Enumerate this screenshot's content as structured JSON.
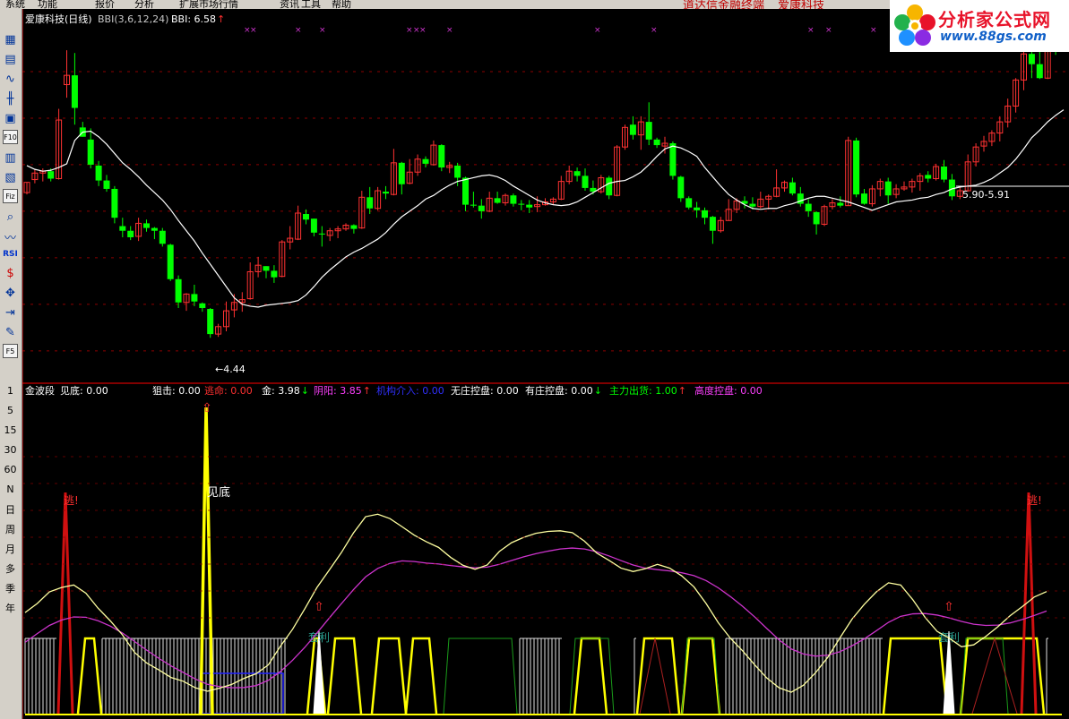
{
  "menu": {
    "items": [
      "系统",
      "功能",
      "报价",
      "分析",
      "扩展市场行情",
      "资讯",
      "工具",
      "帮助"
    ],
    "headline": "道达信金融终端",
    "headline_stock": "爱康科技"
  },
  "logo": {
    "brand": "分析家公式网",
    "url": "www.88gs.com",
    "icon": "flower-logo-icon"
  },
  "toolbar": {
    "icons": [
      "grid-icon",
      "table-icon",
      "line-chart-icon",
      "kline-icon",
      "window-icon",
      "f10-icon",
      "notes-icon",
      "calendar-icon",
      "f10-box-icon",
      "search-icon",
      "wave-icon",
      "rsi-icon",
      "dollar-icon",
      "move-icon",
      "export-icon",
      "draw-pencil-icon",
      "f5-icon"
    ],
    "labels": {
      "f10": "F10",
      "fiz": "Fiz",
      "f5": "F5",
      "rsi": "RSI"
    },
    "periods": [
      "1",
      "5",
      "15",
      "30",
      "60",
      "N",
      "日",
      "周",
      "月",
      "多",
      "季",
      "年"
    ]
  },
  "main_panel": {
    "title": "爱康科技(日线)",
    "indicator": "BBI(3,6,12,24)",
    "bbi_label": "BBI: 6.58",
    "bbi_arrow": "↑",
    "low_label": "←4.44",
    "range_label": "5.90-5.91"
  },
  "sub_panel": {
    "title": "金波段",
    "readouts": [
      {
        "label": "见底:",
        "value": "0.00",
        "color": "#ffffff",
        "arrow": ""
      },
      {
        "label": "狙击:",
        "value": "0.00",
        "color": "#ffffff",
        "arrow": ""
      },
      {
        "label": "逃命:",
        "value": "0.00",
        "color": "#ff3030",
        "arrow": ""
      },
      {
        "label": "金:",
        "value": "3.98",
        "color": "#ffffff",
        "arrow": "↓"
      },
      {
        "label": "阴阳:",
        "value": "3.85",
        "color": "#ff40ff",
        "arrow": "↑"
      },
      {
        "label": "机构介入:",
        "value": "0.00",
        "color": "#3030ff",
        "arrow": ""
      },
      {
        "label": "无庄控盘:",
        "value": "0.00",
        "color": "#ffffff",
        "arrow": ""
      },
      {
        "label": "有庄控盘:",
        "value": "0.00",
        "color": "#ffffff",
        "arrow": "↓"
      },
      {
        "label": "主力出货:",
        "value": "1.00",
        "color": "#00ff00",
        "arrow": "↑"
      },
      {
        "label": "高度控盘:",
        "value": "0.00",
        "color": "#ff40ff",
        "arrow": ""
      }
    ],
    "annotations": {
      "bottom": "见底",
      "escape": "逃!",
      "profit": "套利"
    }
  },
  "colors": {
    "up": "#ff3232",
    "down": "#00ff00",
    "bbi": "#ffffff",
    "gold": "#ffffa0",
    "yinyang": "#cc33cc",
    "yellow": "#ffff00",
    "grid": "#8b0000",
    "axis": "#ff0000"
  },
  "chart_data": [
    {
      "type": "candlestick",
      "title": "爱康科技(日线)",
      "ylim": [
        4.2,
        8.0
      ],
      "candles": [
        [
          6.2,
          6.31,
          6.18,
          6.31
        ],
        [
          6.34,
          6.45,
          6.3,
          6.41
        ],
        [
          6.41,
          6.46,
          6.32,
          6.43
        ],
        [
          6.43,
          6.46,
          6.32,
          6.35
        ],
        [
          6.35,
          7.1,
          6.34,
          6.98
        ],
        [
          7.36,
          7.73,
          7.22,
          7.46
        ],
        [
          7.46,
          7.7,
          6.93,
          7.11
        ],
        [
          6.9,
          6.96,
          6.8,
          6.8
        ],
        [
          6.77,
          6.89,
          6.46,
          6.5
        ],
        [
          6.49,
          6.54,
          6.27,
          6.33
        ],
        [
          6.33,
          6.39,
          6.21,
          6.24
        ],
        [
          6.24,
          6.27,
          5.87,
          5.93
        ],
        [
          5.84,
          5.93,
          5.72,
          5.79
        ],
        [
          5.79,
          5.84,
          5.69,
          5.72
        ],
        [
          5.73,
          5.93,
          5.68,
          5.87
        ],
        [
          5.87,
          5.91,
          5.78,
          5.82
        ],
        [
          5.82,
          5.83,
          5.7,
          5.79
        ],
        [
          5.79,
          5.82,
          5.62,
          5.65
        ],
        [
          5.64,
          5.65,
          5.25,
          5.27
        ],
        [
          5.27,
          5.31,
          4.96,
          5.02
        ],
        [
          5.02,
          5.12,
          4.93,
          5.11
        ],
        [
          5.11,
          5.21,
          4.98,
          5.03
        ],
        [
          5.01,
          5.02,
          4.92,
          4.96
        ],
        [
          4.95,
          4.96,
          4.64,
          4.68
        ],
        [
          4.68,
          4.79,
          4.65,
          4.76
        ],
        [
          4.76,
          5.03,
          4.71,
          4.93
        ],
        [
          4.94,
          5.11,
          4.86,
          5.02
        ],
        [
          5.02,
          5.13,
          4.92,
          5.05
        ],
        [
          5.06,
          5.45,
          5.05,
          5.35
        ],
        [
          5.35,
          5.51,
          5.29,
          5.42
        ],
        [
          5.41,
          5.41,
          5.28,
          5.36
        ],
        [
          5.36,
          5.42,
          5.23,
          5.29
        ],
        [
          5.3,
          5.69,
          5.29,
          5.67
        ],
        [
          5.67,
          5.84,
          5.59,
          5.71
        ],
        [
          5.7,
          6.06,
          5.69,
          5.98
        ],
        [
          5.97,
          6.02,
          5.86,
          5.91
        ],
        [
          5.92,
          5.92,
          5.73,
          5.77
        ],
        [
          5.76,
          5.84,
          5.62,
          5.75
        ],
        [
          5.74,
          5.82,
          5.68,
          5.79
        ],
        [
          5.79,
          5.84,
          5.71,
          5.81
        ],
        [
          5.81,
          5.87,
          5.79,
          5.85
        ],
        [
          5.85,
          5.86,
          5.76,
          5.81
        ],
        [
          5.82,
          6.22,
          5.81,
          6.15
        ],
        [
          6.15,
          6.26,
          5.97,
          6.03
        ],
        [
          6.03,
          6.26,
          6.01,
          6.22
        ],
        [
          6.21,
          6.27,
          6.13,
          6.19
        ],
        [
          6.18,
          6.67,
          6.17,
          6.52
        ],
        [
          6.52,
          6.53,
          6.18,
          6.29
        ],
        [
          6.3,
          6.56,
          6.29,
          6.42
        ],
        [
          6.42,
          6.61,
          6.38,
          6.56
        ],
        [
          6.56,
          6.59,
          6.47,
          6.51
        ],
        [
          6.5,
          6.76,
          6.49,
          6.71
        ],
        [
          6.71,
          6.72,
          6.43,
          6.47
        ],
        [
          6.47,
          6.53,
          6.41,
          6.49
        ],
        [
          6.49,
          6.52,
          6.27,
          6.36
        ],
        [
          6.36,
          6.37,
          6.0,
          6.07
        ],
        [
          6.07,
          6.21,
          6.04,
          6.06
        ],
        [
          6.06,
          6.13,
          5.92,
          6.0
        ],
        [
          6.0,
          6.21,
          5.99,
          6.14
        ],
        [
          6.14,
          6.21,
          6.08,
          6.09
        ],
        [
          6.09,
          6.19,
          6.06,
          6.17
        ],
        [
          6.17,
          6.19,
          6.05,
          6.08
        ],
        [
          6.08,
          6.12,
          6.01,
          6.07
        ],
        [
          6.07,
          6.12,
          5.98,
          6.04
        ],
        [
          6.05,
          6.16,
          5.99,
          6.07
        ],
        [
          6.07,
          6.14,
          6.06,
          6.1
        ],
        [
          6.1,
          6.15,
          6.07,
          6.13
        ],
        [
          6.13,
          6.38,
          6.12,
          6.32
        ],
        [
          6.32,
          6.49,
          6.29,
          6.43
        ],
        [
          6.43,
          6.47,
          6.32,
          6.38
        ],
        [
          6.38,
          6.46,
          6.22,
          6.25
        ],
        [
          6.25,
          6.33,
          6.18,
          6.21
        ],
        [
          6.21,
          6.39,
          6.19,
          6.36
        ],
        [
          6.36,
          6.38,
          6.13,
          6.17
        ],
        [
          6.17,
          6.71,
          6.16,
          6.69
        ],
        [
          6.69,
          6.93,
          6.66,
          6.9
        ],
        [
          6.93,
          7.02,
          6.77,
          6.82
        ],
        [
          6.82,
          7.02,
          6.66,
          6.96
        ],
        [
          6.96,
          7.17,
          6.71,
          6.77
        ],
        [
          6.77,
          6.79,
          6.68,
          6.71
        ],
        [
          6.7,
          6.8,
          6.62,
          6.73
        ],
        [
          6.73,
          6.75,
          6.34,
          6.38
        ],
        [
          6.37,
          6.38,
          6.1,
          6.14
        ],
        [
          6.14,
          6.16,
          6.02,
          6.04
        ],
        [
          6.04,
          6.1,
          5.93,
          6.01
        ],
        [
          6.01,
          6.04,
          5.86,
          5.93
        ],
        [
          5.94,
          5.95,
          5.65,
          5.79
        ],
        [
          5.79,
          5.94,
          5.77,
          5.9
        ],
        [
          5.9,
          6.13,
          5.9,
          6.02
        ],
        [
          6.02,
          6.14,
          5.98,
          6.11
        ],
        [
          6.11,
          6.16,
          6.03,
          6.08
        ],
        [
          6.08,
          6.15,
          6.02,
          6.05
        ],
        [
          6.05,
          6.21,
          6.03,
          6.13
        ],
        [
          6.13,
          6.18,
          6.02,
          6.16
        ],
        [
          6.16,
          6.45,
          6.15,
          6.25
        ],
        [
          6.25,
          6.33,
          6.21,
          6.31
        ],
        [
          6.31,
          6.36,
          6.17,
          6.19
        ],
        [
          6.19,
          6.26,
          6.05,
          6.08
        ],
        [
          6.08,
          6.13,
          5.94,
          6.0
        ],
        [
          5.99,
          6.0,
          5.75,
          5.86
        ],
        [
          5.86,
          6.07,
          5.84,
          6.05
        ],
        [
          6.05,
          6.13,
          6.02,
          6.09
        ],
        [
          6.09,
          6.16,
          6.04,
          6.06
        ],
        [
          6.06,
          6.8,
          6.06,
          6.76
        ],
        [
          6.76,
          6.79,
          6.15,
          6.18
        ],
        [
          6.19,
          6.24,
          6.07,
          6.08
        ],
        [
          6.08,
          6.28,
          6.05,
          6.24
        ],
        [
          6.24,
          6.35,
          6.16,
          6.32
        ],
        [
          6.32,
          6.36,
          6.08,
          6.17
        ],
        [
          6.18,
          6.29,
          6.14,
          6.24
        ],
        [
          6.24,
          6.32,
          6.22,
          6.26
        ],
        [
          6.26,
          6.35,
          6.2,
          6.32
        ],
        [
          6.32,
          6.41,
          6.22,
          6.38
        ],
        [
          6.39,
          6.43,
          6.31,
          6.35
        ],
        [
          6.35,
          6.51,
          6.33,
          6.48
        ],
        [
          6.48,
          6.55,
          6.31,
          6.34
        ],
        [
          6.34,
          6.4,
          6.12,
          6.16
        ],
        [
          6.16,
          6.27,
          6.13,
          6.22
        ],
        [
          6.22,
          6.61,
          6.21,
          6.53
        ],
        [
          6.53,
          6.73,
          6.48,
          6.69
        ],
        [
          6.7,
          6.81,
          6.64,
          6.75
        ],
        [
          6.75,
          6.87,
          6.7,
          6.84
        ],
        [
          6.84,
          7.02,
          6.75,
          6.96
        ],
        [
          6.96,
          7.21,
          6.9,
          7.13
        ],
        [
          7.13,
          7.43,
          7.06,
          7.41
        ],
        [
          7.41,
          7.74,
          7.3,
          7.69
        ],
        [
          7.69,
          7.86,
          7.43,
          7.58
        ],
        [
          7.58,
          7.77,
          7.42,
          7.43
        ],
        [
          7.43,
          7.94,
          7.42,
          7.87
        ],
        [
          7.87,
          7.9,
          7.68,
          7.72
        ]
      ],
      "series": [
        {
          "name": "BBI",
          "values": [
            6.49,
            6.45,
            6.43,
            6.44,
            6.47,
            6.51,
            6.76,
            6.85,
            6.86,
            6.8,
            6.72,
            6.62,
            6.52,
            6.45,
            6.37,
            6.28,
            6.2,
            6.12,
            6.02,
            5.9,
            5.79,
            5.68,
            5.55,
            5.43,
            5.31,
            5.19,
            5.07,
            5.0,
            4.98,
            4.97,
            4.99,
            5.0,
            5.01,
            5.02,
            5.04,
            5.1,
            5.19,
            5.29,
            5.37,
            5.44,
            5.51,
            5.56,
            5.6,
            5.65,
            5.7,
            5.77,
            5.86,
            5.94,
            6.0,
            6.06,
            6.13,
            6.17,
            6.23,
            6.28,
            6.32,
            6.34,
            6.36,
            6.38,
            6.39,
            6.37,
            6.33,
            6.27,
            6.22,
            6.17,
            6.12,
            6.09,
            6.07,
            6.06,
            6.07,
            6.1,
            6.15,
            6.2,
            6.25,
            6.3,
            6.32,
            6.33,
            6.37,
            6.42,
            6.5,
            6.59,
            6.67,
            6.7,
            6.68,
            6.64,
            6.59,
            6.47,
            6.37,
            6.27,
            6.18,
            6.12,
            6.07,
            6.03,
            6.02,
            6.03,
            6.03,
            6.06,
            6.08,
            6.11,
            6.14,
            6.16,
            6.16,
            6.14,
            6.12,
            6.1,
            6.07,
            6.04,
            6.01,
            6.04,
            6.07,
            6.1,
            6.11,
            6.12,
            6.14,
            6.15,
            6.18,
            6.2,
            6.24,
            6.26,
            6.27,
            6.28,
            6.31,
            6.35,
            6.41,
            6.47,
            6.56,
            6.67,
            6.79,
            6.87,
            6.96,
            7.03,
            7.09
          ]
        }
      ],
      "annotations": [
        {
          "text": "←4.44"
        },
        {
          "text": "5.90-5.91"
        }
      ]
    },
    {
      "type": "line",
      "title": "金波段",
      "ylim": [
        0,
        10
      ],
      "series": [
        {
          "name": "金",
          "values": [
            3.31,
            3.6,
            3.97,
            4.11,
            4.19,
            3.93,
            3.45,
            3.05,
            2.6,
            2.04,
            1.7,
            1.48,
            1.24,
            1.12,
            0.91,
            0.8,
            0.9,
            1.02,
            1.21,
            1.36,
            1.64,
            2.24,
            2.78,
            3.43,
            4.11,
            4.66,
            5.22,
            5.85,
            6.37,
            6.45,
            6.31,
            6.05,
            5.78,
            5.57,
            5.39,
            5.07,
            4.82,
            4.69,
            4.83,
            5.26,
            5.54,
            5.71,
            5.84,
            5.9,
            5.92,
            5.86,
            5.59,
            5.21,
            4.98,
            4.73,
            4.62,
            4.71,
            4.85,
            4.73,
            4.48,
            4.13,
            3.6,
            2.99,
            2.49,
            2.09,
            1.64,
            1.22,
            0.91,
            0.77,
            0.99,
            1.39,
            1.88,
            2.5,
            3.1,
            3.57,
            3.97,
            4.26,
            4.19,
            3.72,
            3.16,
            2.71,
            2.49,
            2.22,
            2.28,
            2.55,
            2.86,
            3.21,
            3.5,
            3.81,
            3.98
          ]
        },
        {
          "name": "阴阳",
          "values": [
            2.36,
            2.64,
            2.9,
            3.07,
            3.17,
            3.16,
            3.05,
            2.88,
            2.66,
            2.39,
            2.11,
            1.85,
            1.61,
            1.4,
            1.19,
            1.02,
            0.95,
            0.91,
            0.92,
            0.98,
            1.15,
            1.43,
            1.79,
            2.2,
            2.66,
            3.13,
            3.59,
            4.04,
            4.45,
            4.72,
            4.88,
            4.96,
            4.94,
            4.89,
            4.86,
            4.81,
            4.77,
            4.74,
            4.76,
            4.85,
            4.97,
            5.09,
            5.19,
            5.27,
            5.34,
            5.37,
            5.34,
            5.25,
            5.12,
            4.97,
            4.83,
            4.73,
            4.68,
            4.64,
            4.58,
            4.49,
            4.33,
            4.1,
            3.82,
            3.51,
            3.17,
            2.8,
            2.44,
            2.15,
            1.99,
            1.92,
            1.95,
            2.06,
            2.25,
            2.47,
            2.73,
            3.0,
            3.19,
            3.27,
            3.28,
            3.23,
            3.14,
            3.03,
            2.94,
            2.9,
            2.91,
            2.98,
            3.09,
            3.22,
            3.36
          ]
        }
      ],
      "markers": [
        "见底",
        "逃!",
        "套利"
      ]
    }
  ]
}
